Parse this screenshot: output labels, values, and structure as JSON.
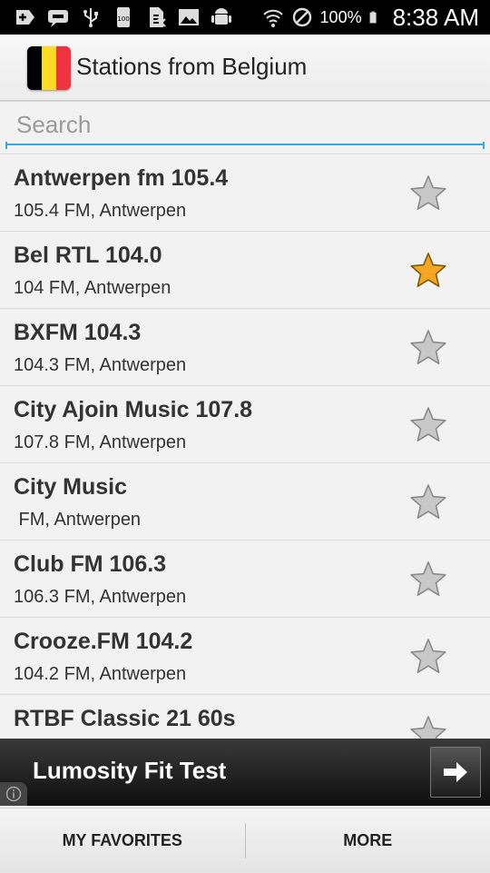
{
  "status_bar": {
    "icons_left": [
      "add-icon",
      "chat-icon",
      "usb-icon",
      "storage-100-icon",
      "sim-icon",
      "image-icon",
      "android-debug-icon"
    ],
    "icons_right": [
      "wifi-icon",
      "no-signal-icon",
      "battery-icon"
    ],
    "battery": "100%",
    "time": "8:38 AM"
  },
  "action_bar": {
    "title": "Stations from Belgium",
    "flag_colors": [
      "#000000",
      "#FDDA24",
      "#EF3340"
    ]
  },
  "search": {
    "placeholder": "Search",
    "value": ""
  },
  "stations": [
    {
      "name": "Antwerpen fm 105.4",
      "meta": "105.4 FM, Antwerpen",
      "favorite": false
    },
    {
      "name": "Bel RTL 104.0",
      "meta": "104 FM, Antwerpen",
      "favorite": true
    },
    {
      "name": "BXFM 104.3",
      "meta": "104.3 FM, Antwerpen",
      "favorite": false
    },
    {
      "name": "City Ajoin Music 107.8",
      "meta": "107.8 FM, Antwerpen",
      "favorite": false
    },
    {
      "name": "City Music",
      "meta": " FM, Antwerpen",
      "favorite": false
    },
    {
      "name": "Club FM 106.3",
      "meta": "106.3 FM, Antwerpen",
      "favorite": false
    },
    {
      "name": "Crooze.FM 104.2",
      "meta": "104.2 FM, Antwerpen",
      "favorite": false
    },
    {
      "name": "RTBF Classic 21 60s",
      "meta": "",
      "favorite": false
    }
  ],
  "ad": {
    "text": "Lumosity Fit Test",
    "button_icon": "arrow-right-icon",
    "info_icon": "info-icon"
  },
  "bottom_bar": {
    "favorites_label": "MY FAVORITES",
    "more_label": "MORE"
  },
  "colors": {
    "accent": "#3aa7d6",
    "star_favorite": "#F5A623",
    "star_default": "#C8C8C8"
  }
}
